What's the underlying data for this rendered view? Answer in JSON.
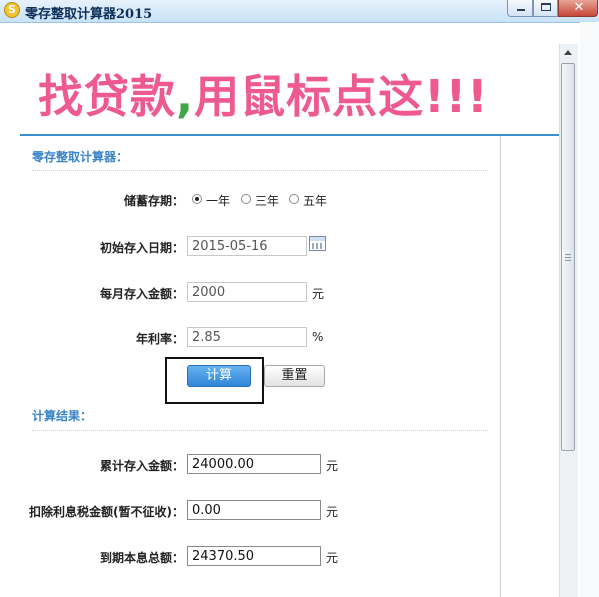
{
  "window": {
    "title": "零存整取计算器2015",
    "icon": "app-coin-icon",
    "icon_glyph": "S",
    "close_glyph": "✕"
  },
  "banner": {
    "text_part1": "找贷款",
    "comma": ",",
    "text_part2": "用鼠标点这!!!"
  },
  "calculator": {
    "section_title": "零存整取计算器：",
    "term": {
      "label": "储蓄存期：",
      "options": [
        "一年",
        "三年",
        "五年"
      ],
      "selected": "一年"
    },
    "start_date": {
      "label": "初始存入日期：",
      "value": "2015-05-16"
    },
    "monthly_amount": {
      "label": "每月存入金额：",
      "value": "2000",
      "unit": "元"
    },
    "annual_rate": {
      "label": "年利率：",
      "value": "2.85",
      "unit": "%"
    },
    "calc_button": "计算",
    "reset_button": "重置"
  },
  "results": {
    "section_title": "计算结果：",
    "total_deposit": {
      "label": "累计存入金额：",
      "value": "24000.00",
      "unit": "元"
    },
    "interest_tax": {
      "label": "扣除利息税金额(暂不征收)：",
      "value": "0.00",
      "unit": "元"
    },
    "maturity_total": {
      "label": "到期本息总额：",
      "value": "24370.50",
      "unit": "元"
    }
  },
  "colors": {
    "banner_pink": "#ee5a8f",
    "banner_comma_green": "#3fa74a",
    "section_blue": "#3a84c8",
    "primary_button": "#2f86d8"
  }
}
